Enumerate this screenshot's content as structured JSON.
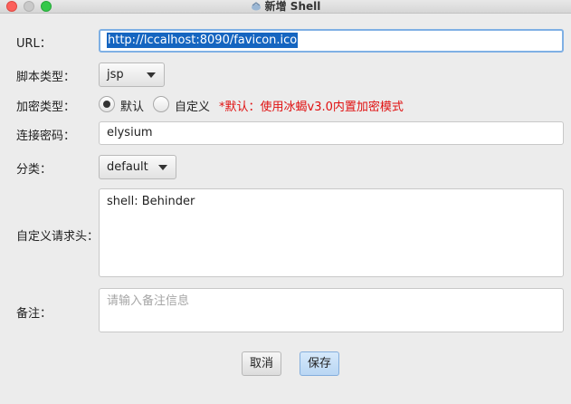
{
  "window": {
    "title": "新增 Shell",
    "title_icon": "shell-app-icon"
  },
  "form": {
    "url": {
      "label": "URL：",
      "value": "http://lccalhost:8090/favicon.ico"
    },
    "script_type": {
      "label": "脚本类型：",
      "selected": "jsp"
    },
    "encryption_type": {
      "label": "加密类型：",
      "options": [
        {
          "label": "默认",
          "checked": true
        },
        {
          "label": "自定义",
          "checked": false
        }
      ],
      "note": "*默认：使用冰蝎v3.0内置加密模式"
    },
    "password": {
      "label": "连接密码：",
      "value": "elysium"
    },
    "category": {
      "label": "分类：",
      "selected": "default"
    },
    "custom_headers": {
      "label": "自定义请求头：",
      "value": "shell: Behinder"
    },
    "remark": {
      "label": "备注：",
      "placeholder": "请输入备注信息",
      "value": ""
    }
  },
  "buttons": {
    "cancel": "取消",
    "save": "保存"
  },
  "colors": {
    "accent": "#7fb0e4",
    "note_red": "#e01010",
    "selection": "#1565c0"
  }
}
